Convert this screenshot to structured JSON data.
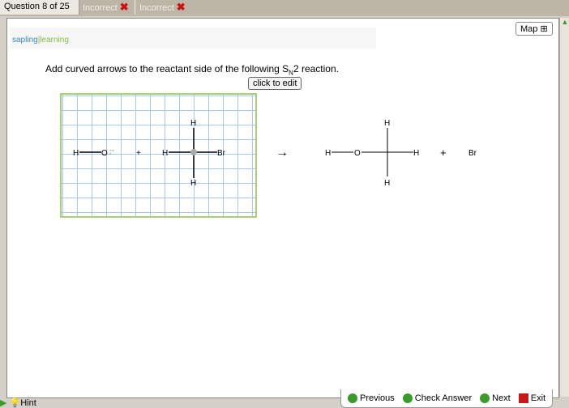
{
  "tabs": {
    "question": "Question 8 of 25",
    "attempts": [
      "Incorrect",
      "Incorrect"
    ]
  },
  "logo": {
    "part1": "sapling",
    "part2": "learning"
  },
  "map_label": "Map",
  "question": {
    "pre": "Add curved arrows to the reactant side of the following S",
    "sub": "N",
    "post": "2 reaction."
  },
  "edit_label": "click to edit",
  "reaction": {
    "plus": "+",
    "arrow": "→",
    "H": "H",
    "O": "O",
    "Br": "Br"
  },
  "nav": {
    "previous": "Previous",
    "check": "Check Answer",
    "next": "Next",
    "exit": "Exit"
  },
  "hint": "Hint"
}
